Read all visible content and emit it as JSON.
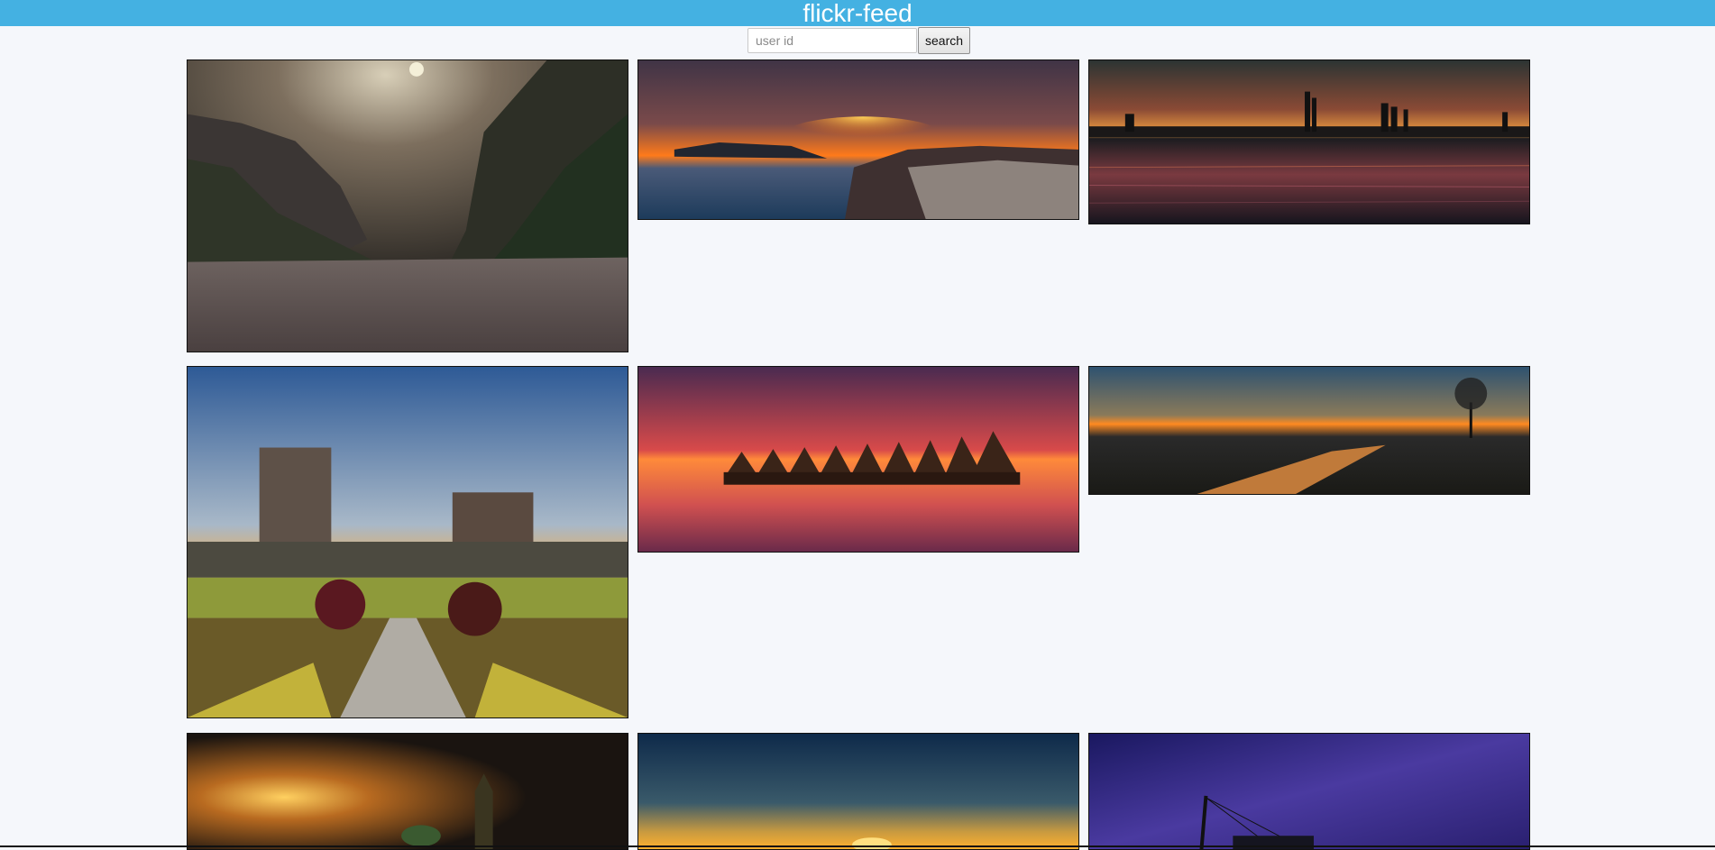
{
  "header": {
    "title": "flickr-feed"
  },
  "search": {
    "placeholder": "user id",
    "value": "",
    "button_label": "search"
  },
  "colors": {
    "header_bg": "#44b1e2",
    "page_bg": "#f5f7fb"
  },
  "photos": [
    {
      "subject": "mountain-valley-river"
    },
    {
      "subject": "coastal-sunset"
    },
    {
      "subject": "city-skyline-water"
    },
    {
      "subject": "castle-garden"
    },
    {
      "subject": "floating-houses-sunset"
    },
    {
      "subject": "river-valley-sunset"
    },
    {
      "subject": "golden-clouds-church"
    },
    {
      "subject": "horizon-sunrise"
    },
    {
      "subject": "purple-sky-bridge"
    }
  ]
}
